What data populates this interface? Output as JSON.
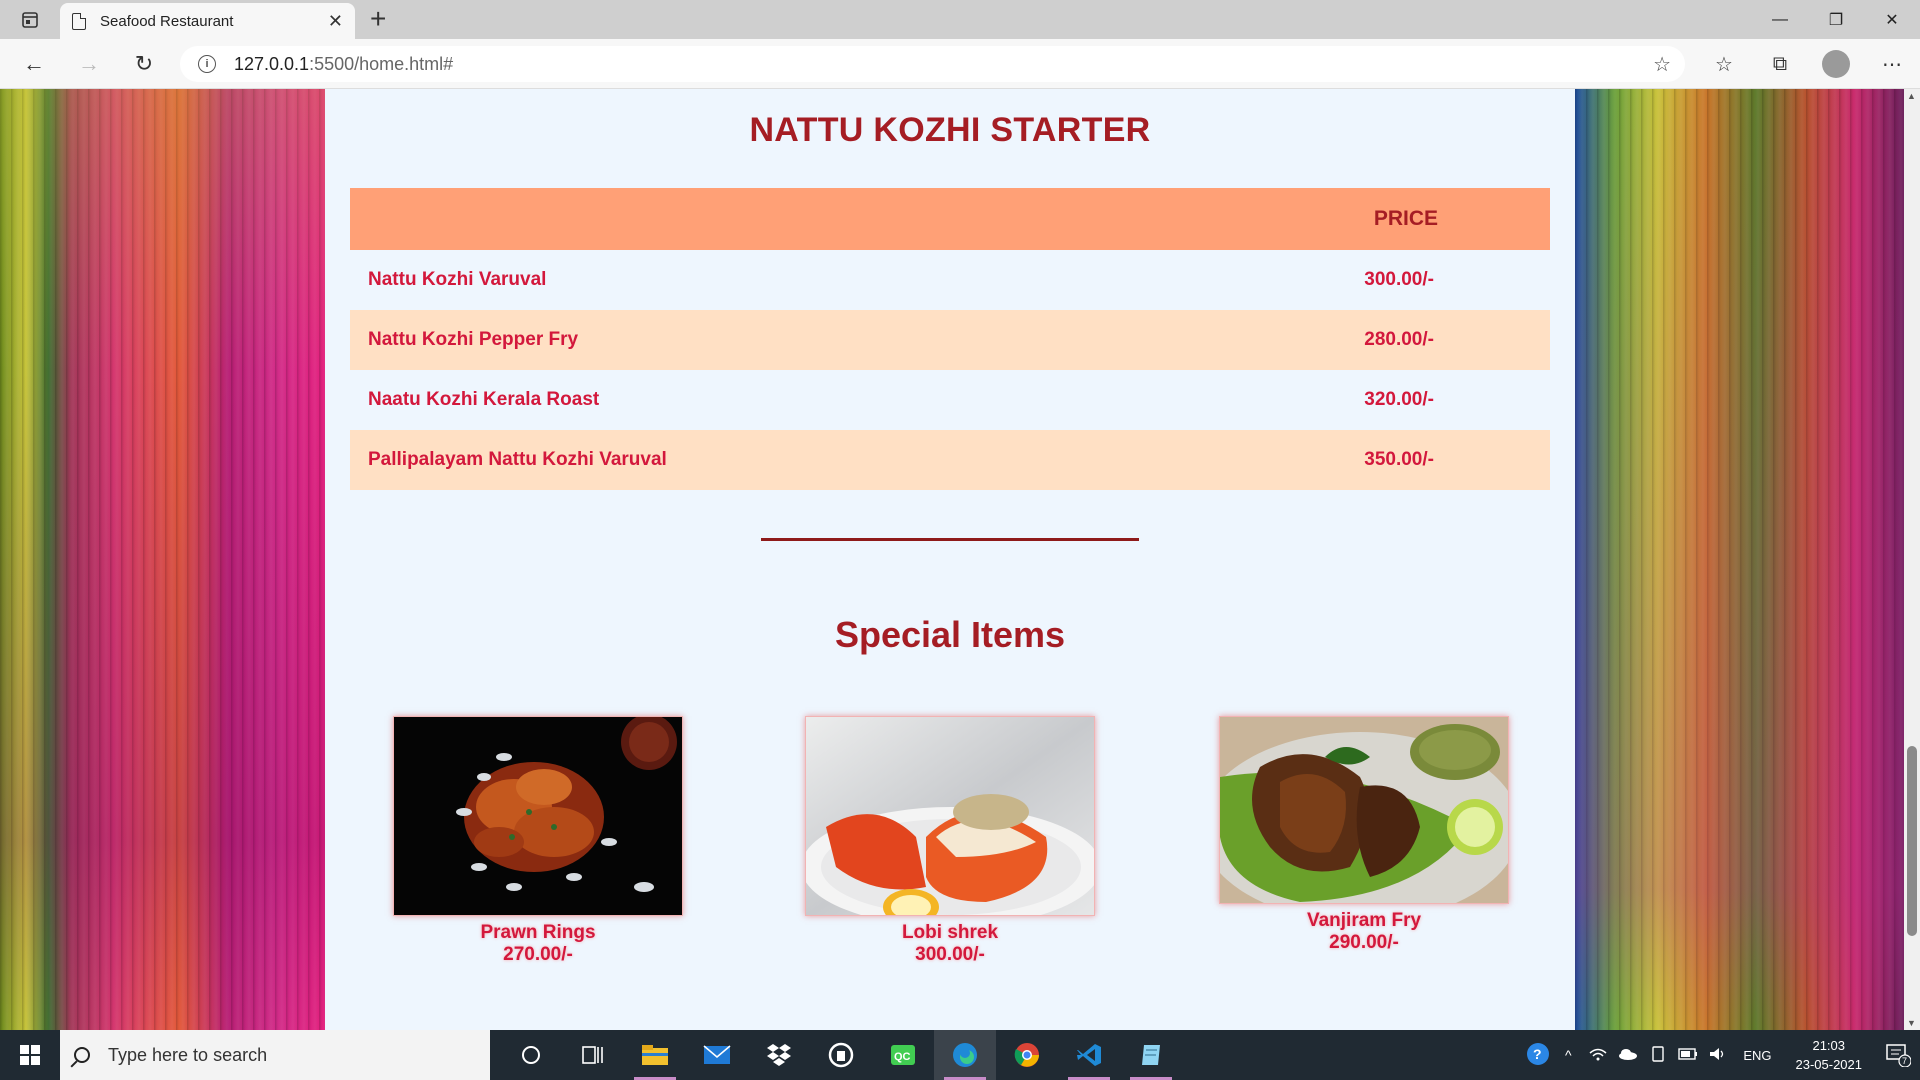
{
  "browser": {
    "tab_title": "Seafood Restaurant",
    "url_host": "127.0.0.1",
    "url_path": ":5500/home.html#"
  },
  "menu": {
    "title": "NATTU KOZHI STARTER",
    "price_header": "PRICE",
    "items": [
      {
        "name": "Nattu Kozhi Varuval",
        "price": "300.00/-"
      },
      {
        "name": "Nattu Kozhi Pepper Fry",
        "price": "280.00/-"
      },
      {
        "name": "Naatu Kozhi Kerala Roast",
        "price": "320.00/-"
      },
      {
        "name": "Pallipalayam Nattu Kozhi Varuval",
        "price": "350.00/-"
      }
    ]
  },
  "specials": {
    "title": "Special Items",
    "items": [
      {
        "name": "Prawn Rings",
        "price": "270.00/-"
      },
      {
        "name": "Lobi shrek",
        "price": "300.00/-"
      },
      {
        "name": "Vanjiram Fry",
        "price": "290.00/-"
      }
    ]
  },
  "taskbar": {
    "search_placeholder": "Type here to search",
    "language": "ENG",
    "time": "21:03",
    "date": "23-05-2021",
    "notification_count": "7"
  }
}
